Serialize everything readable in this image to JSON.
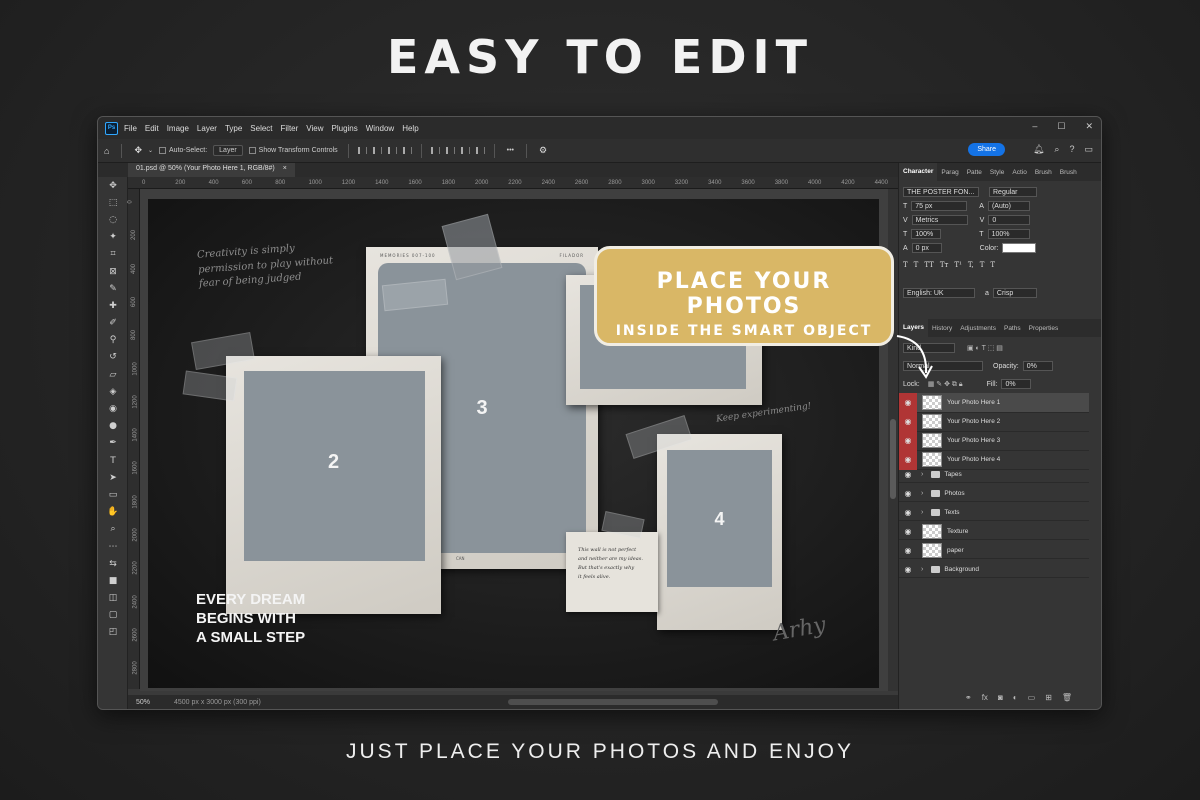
{
  "headline": "EASY TO EDIT",
  "footline": "JUST PLACE YOUR PHOTOS AND ENJOY",
  "app": {
    "logo": "Ps",
    "menu": [
      "File",
      "Edit",
      "Image",
      "Layer",
      "Type",
      "Select",
      "Filter",
      "View",
      "Plugins",
      "Window",
      "Help"
    ],
    "window_controls": [
      "–",
      "☐",
      "✕"
    ]
  },
  "options_bar": {
    "auto_select_label": "Auto-Select:",
    "auto_select_target": "Layer",
    "show_transform_label": "Show Transform Controls",
    "more": "•••",
    "share_label": "Share"
  },
  "document_tab": {
    "title": "01.psd @ 50% (Your Photo Here 1, RGB/8#)",
    "close": "×"
  },
  "ruler_top": [
    "0",
    "200",
    "400",
    "600",
    "800",
    "1000",
    "1200",
    "1400",
    "1600",
    "1800",
    "2000",
    "2200",
    "2400",
    "2600",
    "2800",
    "3000",
    "3200",
    "3400",
    "3600",
    "3800",
    "4000",
    "4200",
    "4400"
  ],
  "ruler_left": [
    "0",
    "200",
    "400",
    "600",
    "800",
    "1000",
    "1200",
    "1400",
    "1600",
    "1800",
    "2000",
    "2200",
    "2400",
    "2600",
    "2800"
  ],
  "status": {
    "zoom": "50%",
    "doc_info": "4500 px x 3000 px (300 ppi)"
  },
  "artboard": {
    "quote_top": [
      "Creativity is simply",
      "permission to play without",
      "fear of being judged"
    ],
    "quote_right": "Keep experimenting!",
    "polaroid_strip": {
      "left": "MEMORIES 007-100",
      "right": "FILADOR"
    },
    "polaroid_caption": "CAN",
    "numbers": [
      "2",
      "3",
      "4"
    ],
    "note_text": [
      "This wall is not perfect",
      "and neither are my ideas.",
      "But that's exactly why",
      "it feels alive."
    ],
    "signature": "Arhy",
    "dream_lines": [
      "EVERY DREAM",
      "BEGINS WITH",
      "A SMALL STEP"
    ]
  },
  "callout": {
    "line1": "PLACE YOUR PHOTOS",
    "line2": "INSIDE THE SMART OBJECT"
  },
  "character_panel": {
    "tabs": [
      "Character",
      "Parag",
      "Patte",
      "Style",
      "Actio",
      "Brush",
      "Brush"
    ],
    "font_family": "THE POSTER FON...",
    "font_style": "Regular",
    "size": "75 px",
    "leading": "(Auto)",
    "kerning": "Metrics",
    "tracking": "0",
    "vscale": "100%",
    "hscale": "100%",
    "baseline": "0 px",
    "color_label": "Color:",
    "language": "English: UK",
    "aa_label": "a",
    "antialias": "Crisp",
    "type_buttons": [
      "T",
      "T",
      "TT",
      "Tт",
      "T¹",
      "T,",
      "T",
      "T"
    ]
  },
  "layers_panel": {
    "tabs": [
      "Layers",
      "History",
      "Adjustments",
      "Paths",
      "Properties"
    ],
    "kind_label": "Kind",
    "blend_mode": "Normal",
    "opacity_label": "Opacity:",
    "opacity": "0%",
    "lock_label": "Lock:",
    "fill_label": "Fill:",
    "fill": "0%",
    "layers": [
      {
        "name": "Your Photo Here 1",
        "type": "smart",
        "selected": true
      },
      {
        "name": "Your Photo Here 2",
        "type": "smart",
        "selected": false
      },
      {
        "name": "Your Photo Here 3",
        "type": "smart",
        "selected": false
      },
      {
        "name": "Your Photo Here 4",
        "type": "smart",
        "selected": false
      },
      {
        "name": "Tapes",
        "type": "group",
        "selected": false
      },
      {
        "name": "Photos",
        "type": "group",
        "selected": false
      },
      {
        "name": "Texts",
        "type": "group",
        "selected": false
      },
      {
        "name": "Texture",
        "type": "image",
        "selected": false
      },
      {
        "name": "paper",
        "type": "image",
        "selected": false
      },
      {
        "name": "Background",
        "type": "group",
        "selected": false
      }
    ],
    "footer_icons": [
      "link-icon",
      "fx-icon",
      "mask-icon",
      "adjustment-icon",
      "folder-icon",
      "new-layer-icon",
      "trash-icon"
    ]
  },
  "colors": {
    "accent": "#1473e6",
    "callout": "#d9b766",
    "eye_active": "#b03535",
    "photo_placeholder": "#8a939a"
  }
}
